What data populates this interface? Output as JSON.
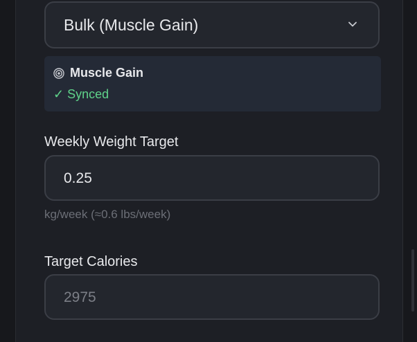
{
  "goal_select": {
    "value": "Bulk (Muscle Gain)",
    "chevron_icon": "chevron-down-icon"
  },
  "goal_card": {
    "icon": "target-icon",
    "title": "Muscle Gain",
    "status": "✓ Synced"
  },
  "weekly_weight": {
    "label": "Weekly Weight Target",
    "value": "0.25",
    "helper": "kg/week (≈0.6 lbs/week)"
  },
  "target_calories": {
    "label": "Target Calories",
    "value": "2975"
  },
  "colors": {
    "background": "#15161a",
    "panel": "#1d1f25",
    "input_bg": "#23262d",
    "input_border": "#3b3e46",
    "card_bg": "#242a36",
    "synced_green": "#5fd38a",
    "text_primary": "#e8e9ec",
    "text_muted": "#6c6f77"
  }
}
